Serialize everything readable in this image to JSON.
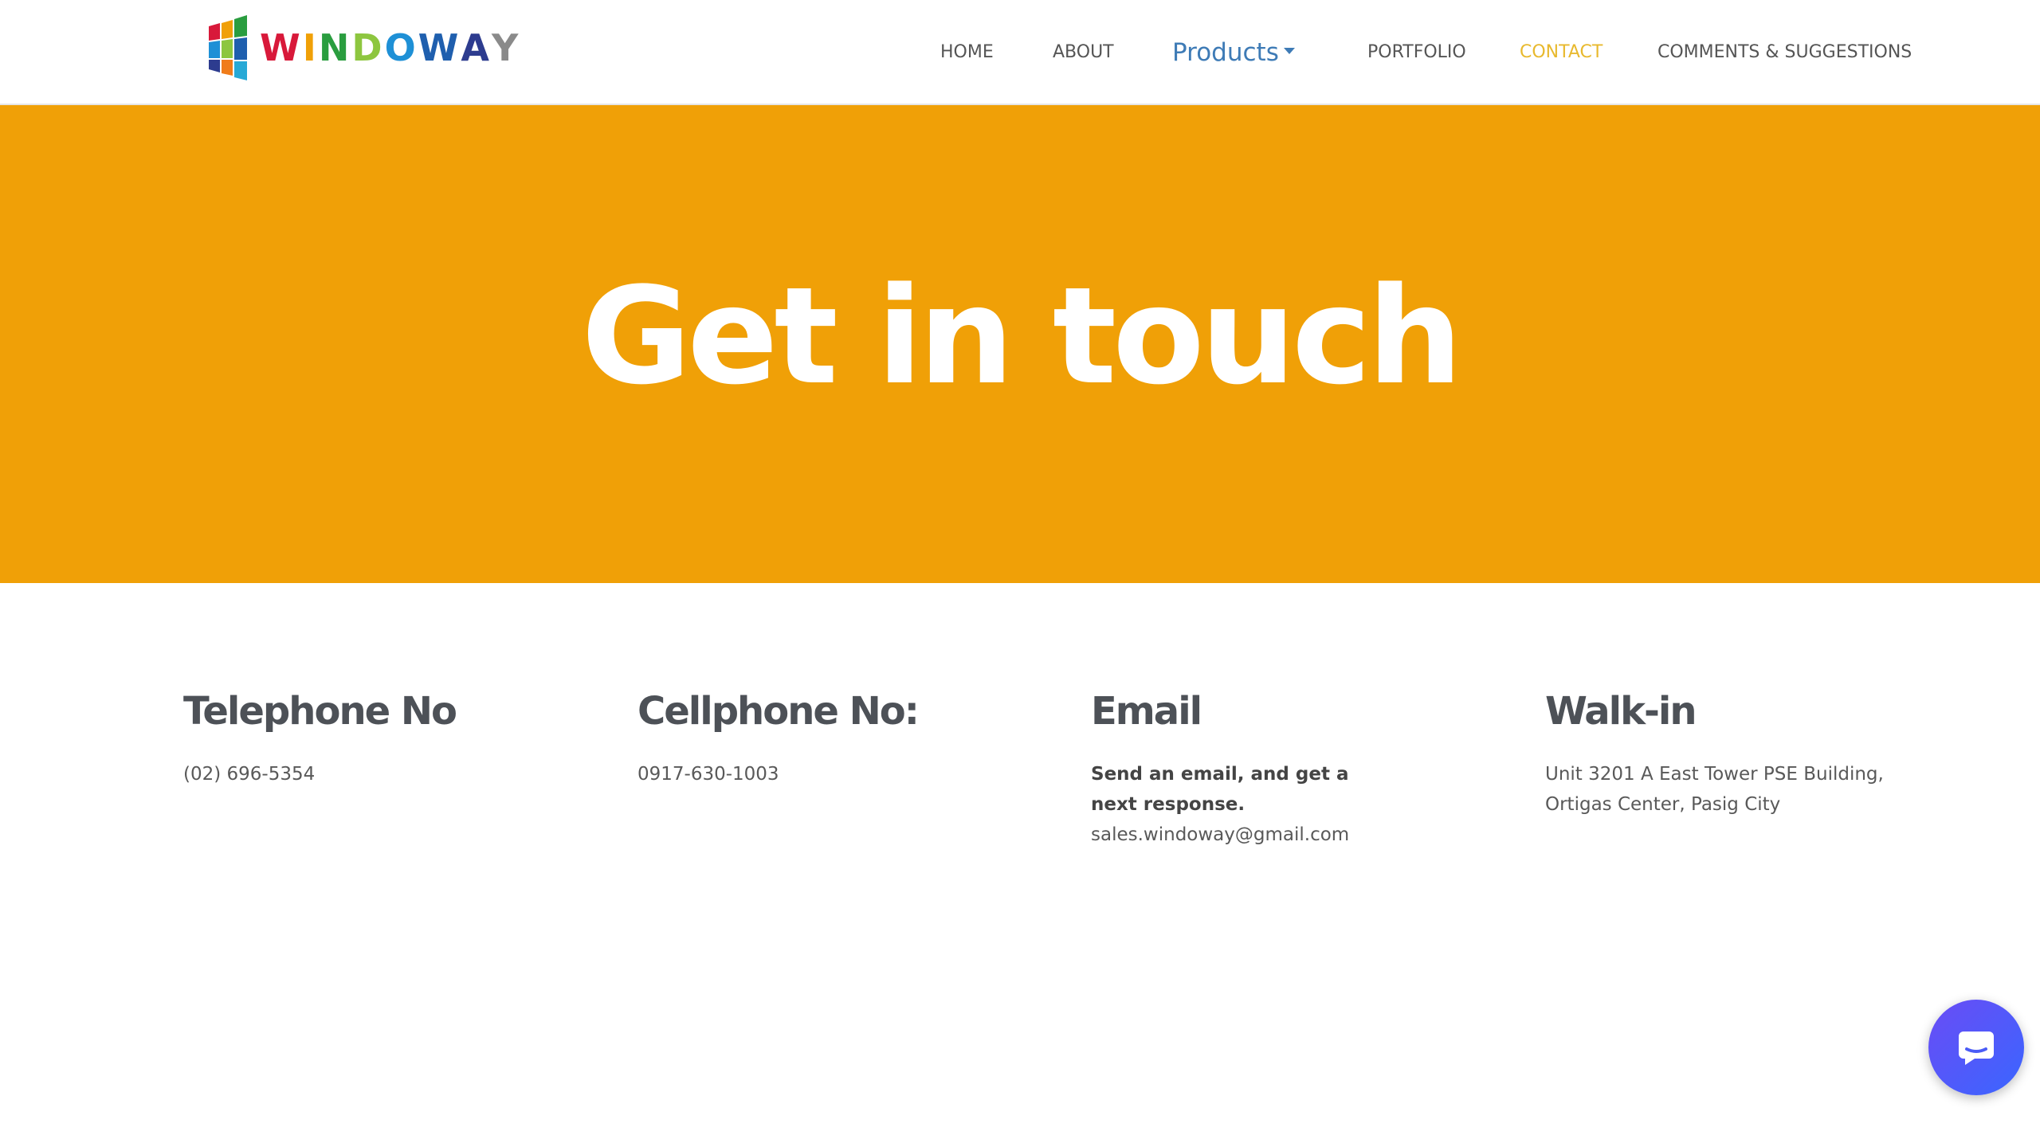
{
  "brand": {
    "name": "WINDOWAY",
    "letters": [
      {
        "ch": "W",
        "color": "#d8193a"
      },
      {
        "ch": "I",
        "color": "#f0a007"
      },
      {
        "ch": "N",
        "color": "#2a9d3f"
      },
      {
        "ch": "D",
        "color": "#8dc63f"
      },
      {
        "ch": "O",
        "color": "#1e90d6"
      },
      {
        "ch": "W",
        "color": "#1f5fae"
      },
      {
        "ch": "A",
        "color": "#2d3c8f"
      },
      {
        "ch": "Y",
        "color": "#8a8a8a"
      }
    ]
  },
  "nav": {
    "home": "HOME",
    "about": "ABOUT",
    "products": "Products",
    "portfolio": "PORTFOLIO",
    "contact": "CONTACT",
    "comments": "COMMENTS & SUGGESTIONS",
    "active": "contact"
  },
  "hero": {
    "title": "Get in touch",
    "background": "#f0a007"
  },
  "contact": {
    "telephone": {
      "heading": "Telephone No",
      "value": "(02) 696-5354"
    },
    "cellphone": {
      "heading": "Cellphone No:",
      "value": "0917-630-1003"
    },
    "email": {
      "heading": "Email",
      "note": "Send an email, and get a next response.",
      "value": "sales.windoway@gmail.com"
    },
    "walkin": {
      "heading": "Walk-in",
      "value": "Unit 3201 A East Tower PSE Building, Ortigas Center, Pasig City"
    }
  },
  "chat_widget": {
    "icon": "chat-icon"
  }
}
